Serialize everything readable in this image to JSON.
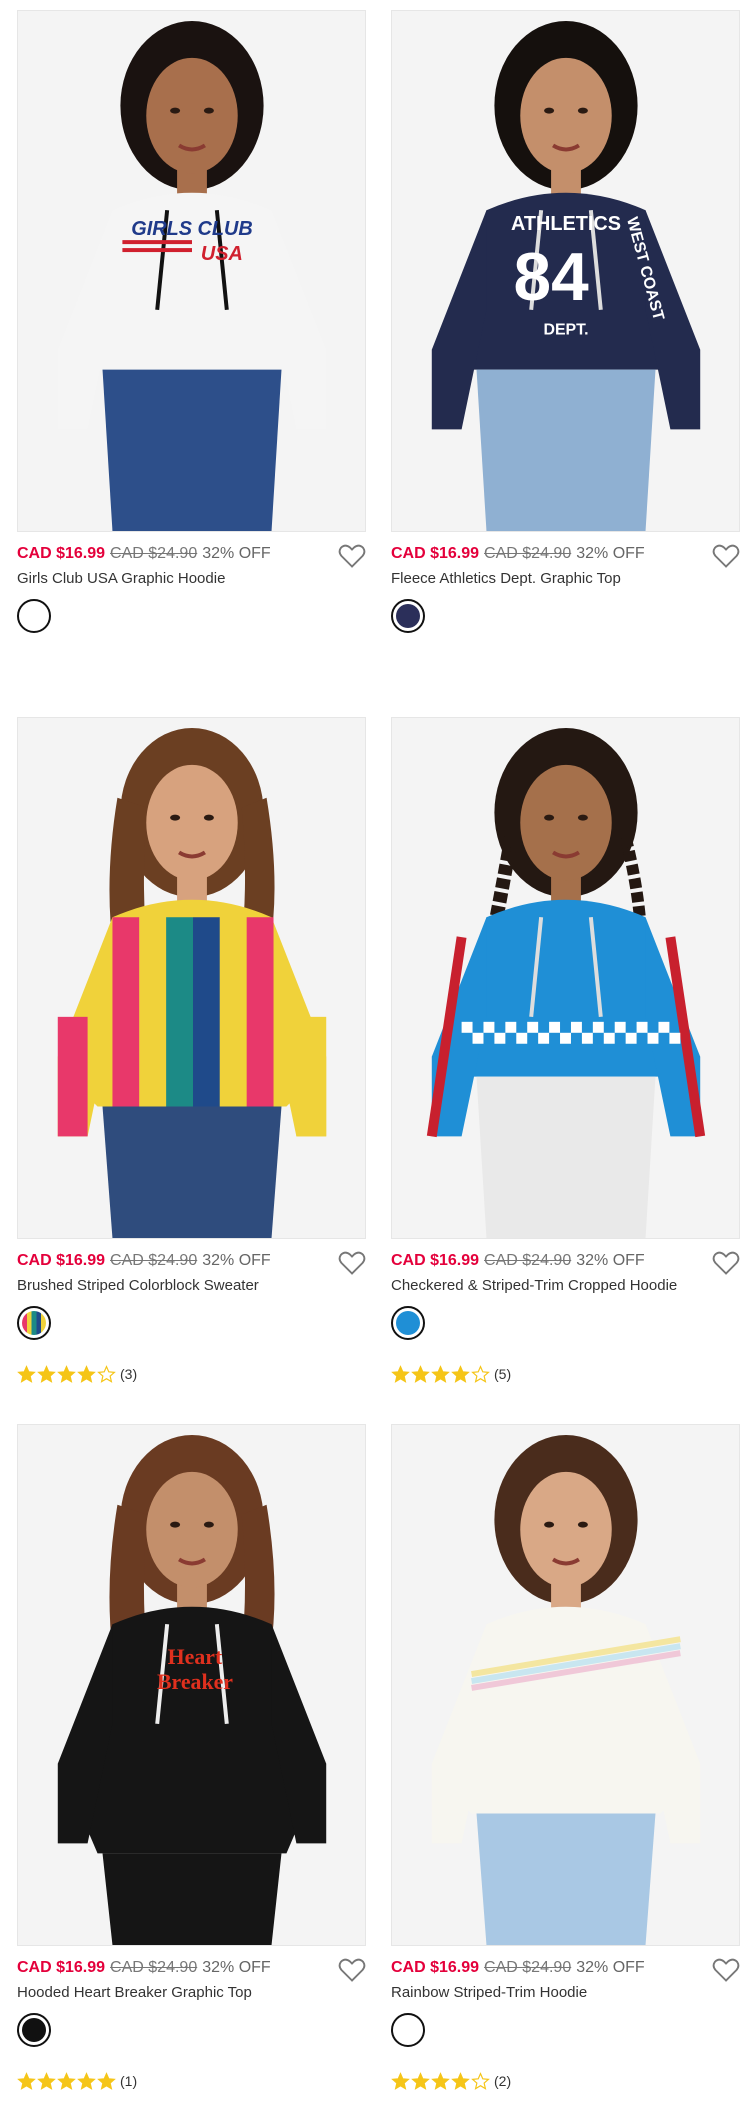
{
  "products": [
    {
      "name": "Girls Club USA Graphic Hoodie",
      "sale_price": "CAD $16.99",
      "orig_price": "CAD $24.90",
      "discount": "32% OFF",
      "swatch": {
        "color": "#ffffff"
      },
      "rating": null,
      "graphic_text": [
        "GIRLS CLUB",
        "USA"
      ],
      "colors": {
        "top": "#f5f5f5",
        "bottom": "#2d4f8a",
        "hair": "#1a1210",
        "skin": "#a86f4c"
      }
    },
    {
      "name": "Fleece Athletics Dept. Graphic Top",
      "sale_price": "CAD $16.99",
      "orig_price": "CAD $24.90",
      "discount": "32% OFF",
      "swatch": {
        "color": "#2b2f5a"
      },
      "rating": null,
      "graphic_text": [
        "ATHLETICS",
        "84",
        "WEST COAST",
        "DEPT."
      ],
      "colors": {
        "top": "#232b4e",
        "bottom": "#8fb0d2",
        "hair": "#15100d",
        "skin": "#c48f6b"
      }
    },
    {
      "name": "Brushed Striped Colorblock Sweater",
      "sale_price": "CAD $16.99",
      "orig_price": "CAD $24.90",
      "discount": "32% OFF",
      "swatch": {
        "color": "stripes"
      },
      "rating": {
        "stars": 4,
        "count": "(3)"
      },
      "graphic_text": [],
      "colors": {
        "top": "#f0d23a",
        "bottom": "#2f4c7d",
        "hair": "#6b3f22",
        "skin": "#d7a27e"
      }
    },
    {
      "name": "Checkered & Striped-Trim Cropped Hoodie",
      "sale_price": "CAD $16.99",
      "orig_price": "CAD $24.90",
      "discount": "32% OFF",
      "swatch": {
        "color": "#1f8fd6"
      },
      "rating": {
        "stars": 4,
        "count": "(5)"
      },
      "graphic_text": [],
      "colors": {
        "top": "#1f8fd6",
        "bottom": "#e9e9e9",
        "hair": "#241812",
        "skin": "#a5704b"
      }
    },
    {
      "name": "Hooded Heart Breaker Graphic Top",
      "sale_price": "CAD $16.99",
      "orig_price": "CAD $24.90",
      "discount": "32% OFF",
      "swatch": {
        "color": "#111111"
      },
      "rating": {
        "stars": 5,
        "count": "(1)"
      },
      "graphic_text": [
        "Heart",
        "Breaker"
      ],
      "colors": {
        "top": "#151515",
        "bottom": "#151515",
        "hair": "#6a3b22",
        "skin": "#c38f6b"
      }
    },
    {
      "name": "Rainbow Striped-Trim Hoodie",
      "sale_price": "CAD $16.99",
      "orig_price": "CAD $24.90",
      "discount": "32% OFF",
      "swatch": {
        "color": "#ffffff"
      },
      "rating": {
        "stars": 4,
        "count": "(2)"
      },
      "graphic_text": [],
      "colors": {
        "top": "#f7f6f0",
        "bottom": "#a9c8e4",
        "hair": "#4a2c1c",
        "skin": "#d9a886"
      }
    }
  ],
  "icons": {
    "wishlist": "heart-outline-icon",
    "star": "star-icon"
  },
  "accent": {
    "sale": "#e4003b",
    "star": "#f5c518"
  }
}
